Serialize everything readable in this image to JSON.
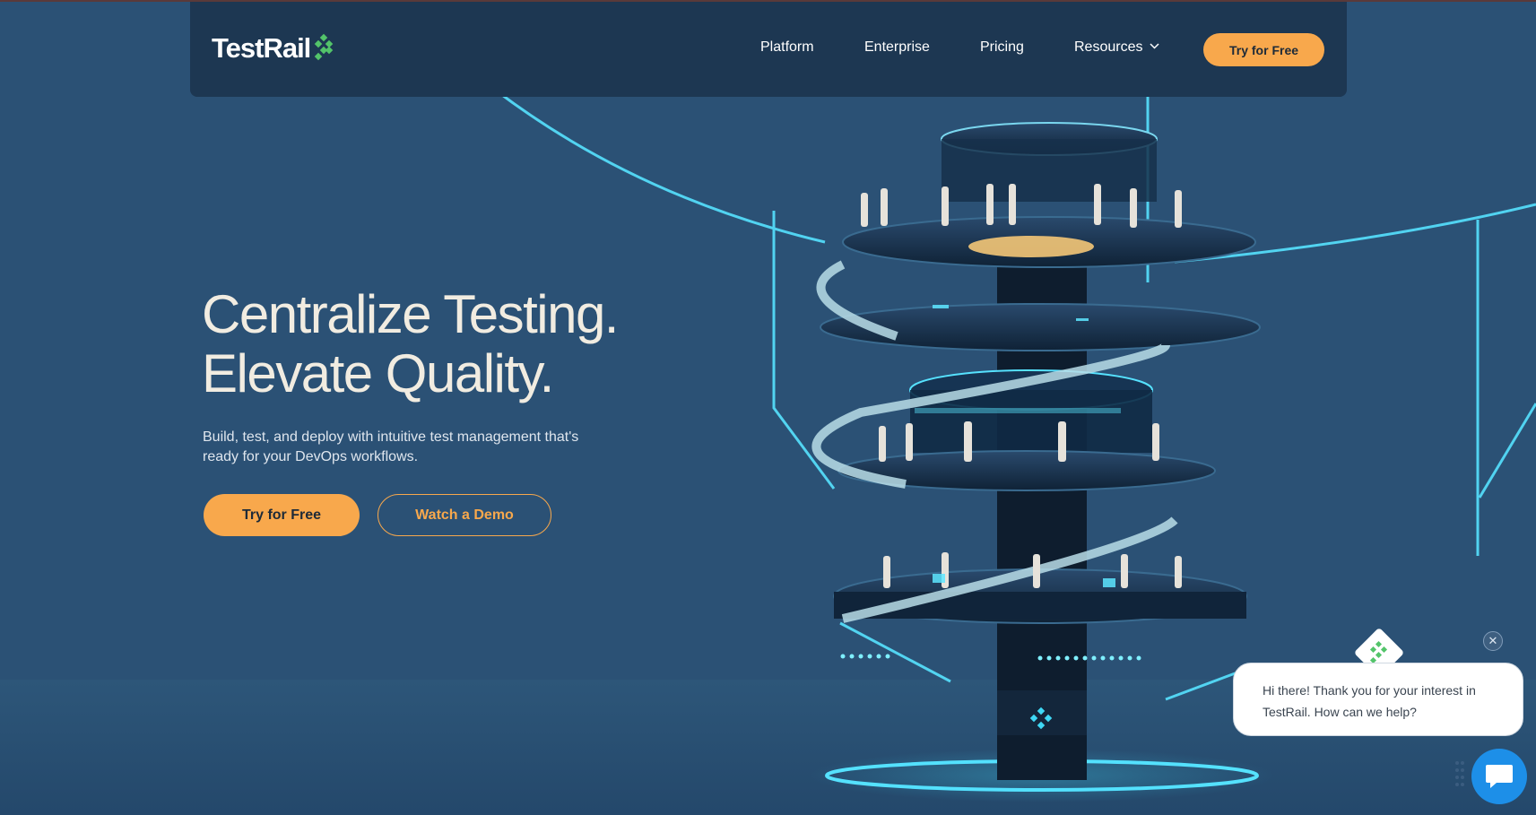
{
  "colors": {
    "background": "#2b5175",
    "navbar": "#1d3752",
    "accent": "#f8a84c",
    "logo_mark": "#53c46a",
    "neon": "#3fd8f5",
    "chat_launcher": "#1d8fe8"
  },
  "header": {
    "logo_text": "TestRail",
    "logo_icon": "testrail-diamond-icon",
    "nav": [
      {
        "label": "Platform"
      },
      {
        "label": "Enterprise"
      },
      {
        "label": "Pricing"
      },
      {
        "label": "Resources",
        "icon": "chevron-down-icon"
      }
    ],
    "cta_label": "Try for Free"
  },
  "hero": {
    "title_line1": "Centralize Testing.",
    "title_line2": "Elevate Quality.",
    "subtitle": "Build, test, and deploy with intuitive test management that's ready for your DevOps workflows.",
    "primary_button": "Try for Free",
    "secondary_button": "Watch a Demo"
  },
  "illustration": {
    "description_icon": "testing-tower-illustration",
    "mark_icon": "testrail-diamond-icon"
  },
  "chat": {
    "message": "Hi there! Thank you for your interest in TestRail. How can we help?",
    "close_icon": "close-icon",
    "launcher_icon": "chat-bubble-icon",
    "badge_icon": "testrail-diamond-icon"
  }
}
